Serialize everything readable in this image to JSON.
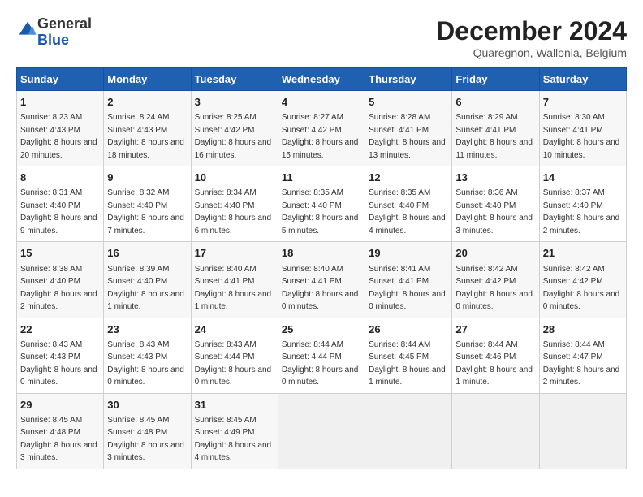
{
  "header": {
    "logo_line1": "General",
    "logo_line2": "Blue",
    "month_title": "December 2024",
    "location": "Quaregnon, Wallonia, Belgium"
  },
  "weekdays": [
    "Sunday",
    "Monday",
    "Tuesday",
    "Wednesday",
    "Thursday",
    "Friday",
    "Saturday"
  ],
  "weeks": [
    [
      {
        "day": "1",
        "sunrise": "8:23 AM",
        "sunset": "4:43 PM",
        "daylight": "8 hours and 20 minutes."
      },
      {
        "day": "2",
        "sunrise": "8:24 AM",
        "sunset": "4:43 PM",
        "daylight": "8 hours and 18 minutes."
      },
      {
        "day": "3",
        "sunrise": "8:25 AM",
        "sunset": "4:42 PM",
        "daylight": "8 hours and 16 minutes."
      },
      {
        "day": "4",
        "sunrise": "8:27 AM",
        "sunset": "4:42 PM",
        "daylight": "8 hours and 15 minutes."
      },
      {
        "day": "5",
        "sunrise": "8:28 AM",
        "sunset": "4:41 PM",
        "daylight": "8 hours and 13 minutes."
      },
      {
        "day": "6",
        "sunrise": "8:29 AM",
        "sunset": "4:41 PM",
        "daylight": "8 hours and 11 minutes."
      },
      {
        "day": "7",
        "sunrise": "8:30 AM",
        "sunset": "4:41 PM",
        "daylight": "8 hours and 10 minutes."
      }
    ],
    [
      {
        "day": "8",
        "sunrise": "8:31 AM",
        "sunset": "4:40 PM",
        "daylight": "8 hours and 9 minutes."
      },
      {
        "day": "9",
        "sunrise": "8:32 AM",
        "sunset": "4:40 PM",
        "daylight": "8 hours and 7 minutes."
      },
      {
        "day": "10",
        "sunrise": "8:34 AM",
        "sunset": "4:40 PM",
        "daylight": "8 hours and 6 minutes."
      },
      {
        "day": "11",
        "sunrise": "8:35 AM",
        "sunset": "4:40 PM",
        "daylight": "8 hours and 5 minutes."
      },
      {
        "day": "12",
        "sunrise": "8:35 AM",
        "sunset": "4:40 PM",
        "daylight": "8 hours and 4 minutes."
      },
      {
        "day": "13",
        "sunrise": "8:36 AM",
        "sunset": "4:40 PM",
        "daylight": "8 hours and 3 minutes."
      },
      {
        "day": "14",
        "sunrise": "8:37 AM",
        "sunset": "4:40 PM",
        "daylight": "8 hours and 2 minutes."
      }
    ],
    [
      {
        "day": "15",
        "sunrise": "8:38 AM",
        "sunset": "4:40 PM",
        "daylight": "8 hours and 2 minutes."
      },
      {
        "day": "16",
        "sunrise": "8:39 AM",
        "sunset": "4:40 PM",
        "daylight": "8 hours and 1 minute."
      },
      {
        "day": "17",
        "sunrise": "8:40 AM",
        "sunset": "4:41 PM",
        "daylight": "8 hours and 1 minute."
      },
      {
        "day": "18",
        "sunrise": "8:40 AM",
        "sunset": "4:41 PM",
        "daylight": "8 hours and 0 minutes."
      },
      {
        "day": "19",
        "sunrise": "8:41 AM",
        "sunset": "4:41 PM",
        "daylight": "8 hours and 0 minutes."
      },
      {
        "day": "20",
        "sunrise": "8:42 AM",
        "sunset": "4:42 PM",
        "daylight": "8 hours and 0 minutes."
      },
      {
        "day": "21",
        "sunrise": "8:42 AM",
        "sunset": "4:42 PM",
        "daylight": "8 hours and 0 minutes."
      }
    ],
    [
      {
        "day": "22",
        "sunrise": "8:43 AM",
        "sunset": "4:43 PM",
        "daylight": "8 hours and 0 minutes."
      },
      {
        "day": "23",
        "sunrise": "8:43 AM",
        "sunset": "4:43 PM",
        "daylight": "8 hours and 0 minutes."
      },
      {
        "day": "24",
        "sunrise": "8:43 AM",
        "sunset": "4:44 PM",
        "daylight": "8 hours and 0 minutes."
      },
      {
        "day": "25",
        "sunrise": "8:44 AM",
        "sunset": "4:44 PM",
        "daylight": "8 hours and 0 minutes."
      },
      {
        "day": "26",
        "sunrise": "8:44 AM",
        "sunset": "4:45 PM",
        "daylight": "8 hours and 1 minute."
      },
      {
        "day": "27",
        "sunrise": "8:44 AM",
        "sunset": "4:46 PM",
        "daylight": "8 hours and 1 minute."
      },
      {
        "day": "28",
        "sunrise": "8:44 AM",
        "sunset": "4:47 PM",
        "daylight": "8 hours and 2 minutes."
      }
    ],
    [
      {
        "day": "29",
        "sunrise": "8:45 AM",
        "sunset": "4:48 PM",
        "daylight": "8 hours and 3 minutes."
      },
      {
        "day": "30",
        "sunrise": "8:45 AM",
        "sunset": "4:48 PM",
        "daylight": "8 hours and 3 minutes."
      },
      {
        "day": "31",
        "sunrise": "8:45 AM",
        "sunset": "4:49 PM",
        "daylight": "8 hours and 4 minutes."
      },
      null,
      null,
      null,
      null
    ]
  ]
}
